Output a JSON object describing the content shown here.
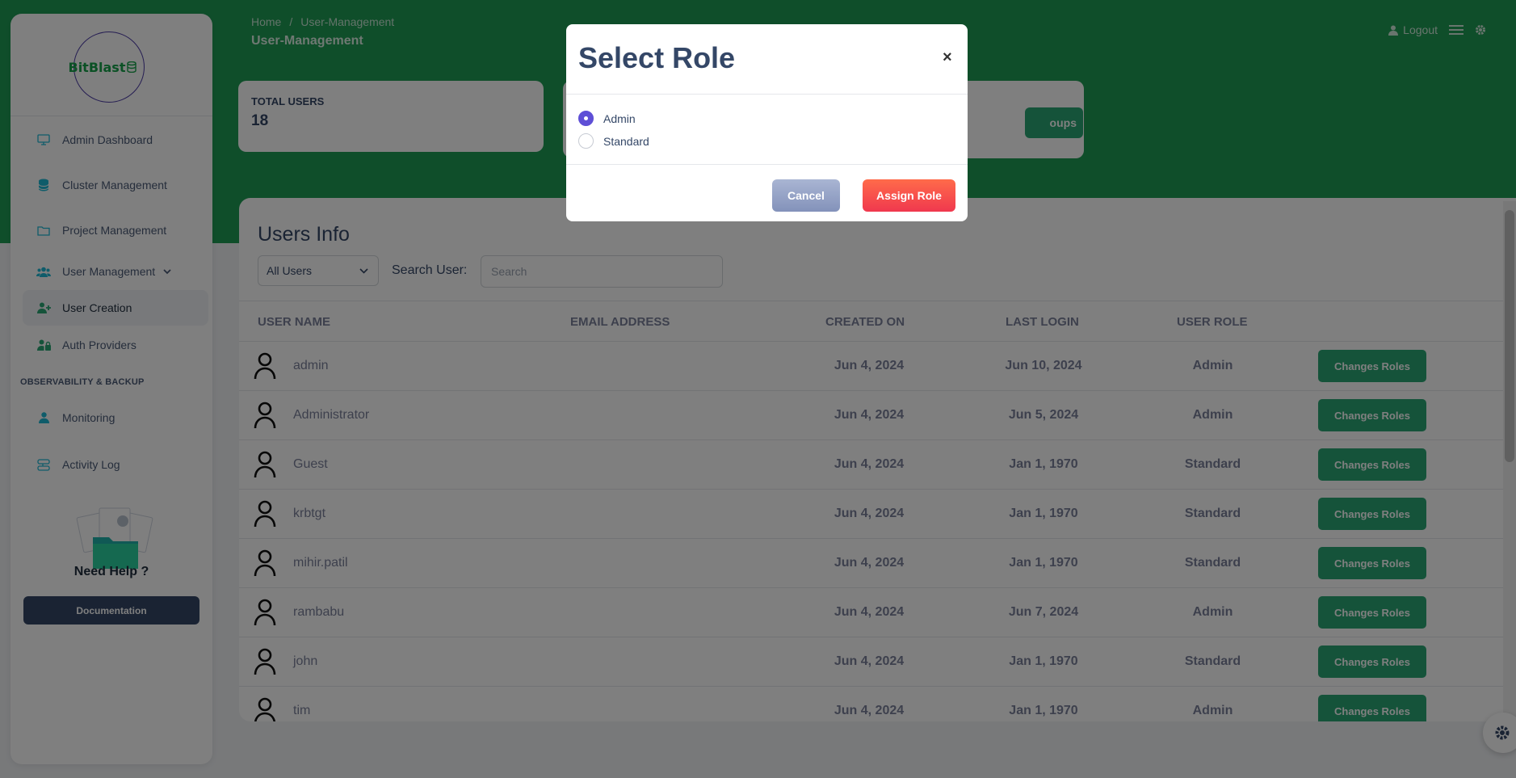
{
  "brand": {
    "name": "BitBlast"
  },
  "breadcrumb": {
    "home": "Home",
    "separator": "/",
    "current": "User-Management"
  },
  "header": {
    "title": "User-Management",
    "logout": "Logout"
  },
  "sidebar": {
    "items": [
      {
        "label": "Admin Dashboard",
        "icon": "monitor-icon"
      },
      {
        "label": "Cluster Management",
        "icon": "database-icon"
      },
      {
        "label": "Project Management",
        "icon": "folder-icon"
      },
      {
        "label": "User Management",
        "icon": "users-icon"
      },
      {
        "label": "User Creation",
        "icon": "user-plus-icon"
      },
      {
        "label": "Auth Providers",
        "icon": "user-lock-icon"
      }
    ],
    "section_title": "OBSERVABILITY & BACKUP",
    "section_items": [
      {
        "label": "Monitoring",
        "icon": "user-icon"
      },
      {
        "label": "Activity Log",
        "icon": "activity-icon"
      }
    ],
    "help": {
      "title": "Need Help ?",
      "button": "Documentation"
    }
  },
  "stats": {
    "total_users_label": "TOTAL USERS",
    "total_users_value": "18",
    "groups_button_partial": "oups"
  },
  "users": {
    "title": "Users Info",
    "filter_selected": "All Users",
    "search_label": "Search User:",
    "search_placeholder": "Search",
    "columns": [
      "USER NAME",
      "EMAIL ADDRESS",
      "CREATED ON",
      "LAST LOGIN",
      "USER ROLE"
    ],
    "action_label": "Changes Roles",
    "rows": [
      {
        "name": "admin",
        "email": "",
        "created": "Jun 4, 2024",
        "last_login": "Jun 10, 2024",
        "role": "Admin"
      },
      {
        "name": "Administrator",
        "email": "",
        "created": "Jun 4, 2024",
        "last_login": "Jun 5, 2024",
        "role": "Admin"
      },
      {
        "name": "Guest",
        "email": "",
        "created": "Jun 4, 2024",
        "last_login": "Jan 1, 1970",
        "role": "Standard"
      },
      {
        "name": "krbtgt",
        "email": "",
        "created": "Jun 4, 2024",
        "last_login": "Jan 1, 1970",
        "role": "Standard"
      },
      {
        "name": "mihir.patil",
        "email": "",
        "created": "Jun 4, 2024",
        "last_login": "Jan 1, 1970",
        "role": "Standard"
      },
      {
        "name": "rambabu",
        "email": "",
        "created": "Jun 4, 2024",
        "last_login": "Jun 7, 2024",
        "role": "Admin"
      },
      {
        "name": "john",
        "email": "",
        "created": "Jun 4, 2024",
        "last_login": "Jan 1, 1970",
        "role": "Standard"
      },
      {
        "name": "tim",
        "email": "",
        "created": "Jun 4, 2024",
        "last_login": "Jan 1, 1970",
        "role": "Admin"
      }
    ]
  },
  "modal": {
    "title": "Select Role",
    "close": "×",
    "options": [
      {
        "label": "Admin",
        "selected": true
      },
      {
        "label": "Standard",
        "selected": false
      }
    ],
    "cancel": "Cancel",
    "assign": "Assign Role"
  },
  "colors": {
    "header_green": "#1f9d55",
    "action_green": "#2aa774",
    "primary_dark": "#344767",
    "radio_accent": "#5e4fd6",
    "assign_red": "#f0384e"
  }
}
